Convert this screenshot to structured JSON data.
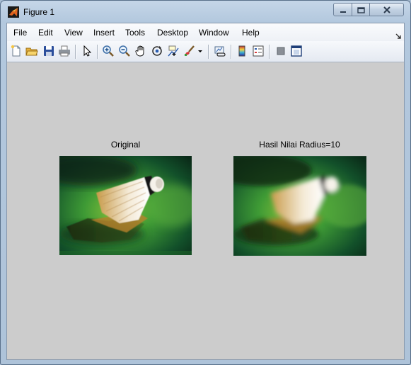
{
  "window": {
    "title": "Figure 1",
    "controls": [
      "minimize-icon",
      "maximize-icon",
      "close-icon"
    ]
  },
  "menubar": {
    "items": [
      "File",
      "Edit",
      "View",
      "Insert",
      "Tools",
      "Desktop",
      "Window",
      "Help"
    ]
  },
  "toolbar": {
    "icons": [
      "new-figure-icon",
      "open-file-icon",
      "save-icon",
      "print-icon",
      "edit-plot-arrow-icon",
      "zoom-in-icon",
      "zoom-out-icon",
      "pan-hand-icon",
      "rotate-3d-icon",
      "data-cursor-icon",
      "brush-icon",
      "brush-dropdown-icon",
      "link-plot-icon",
      "colorbar-icon",
      "legend-icon",
      "hide-plot-tools-icon",
      "show-plot-tools-icon"
    ]
  },
  "figure": {
    "axes": [
      {
        "title": "Original",
        "image": "shuttlecock-sharp"
      },
      {
        "title": "Hasil Nilai Radius=10",
        "image": "shuttlecock-blurred"
      }
    ]
  }
}
